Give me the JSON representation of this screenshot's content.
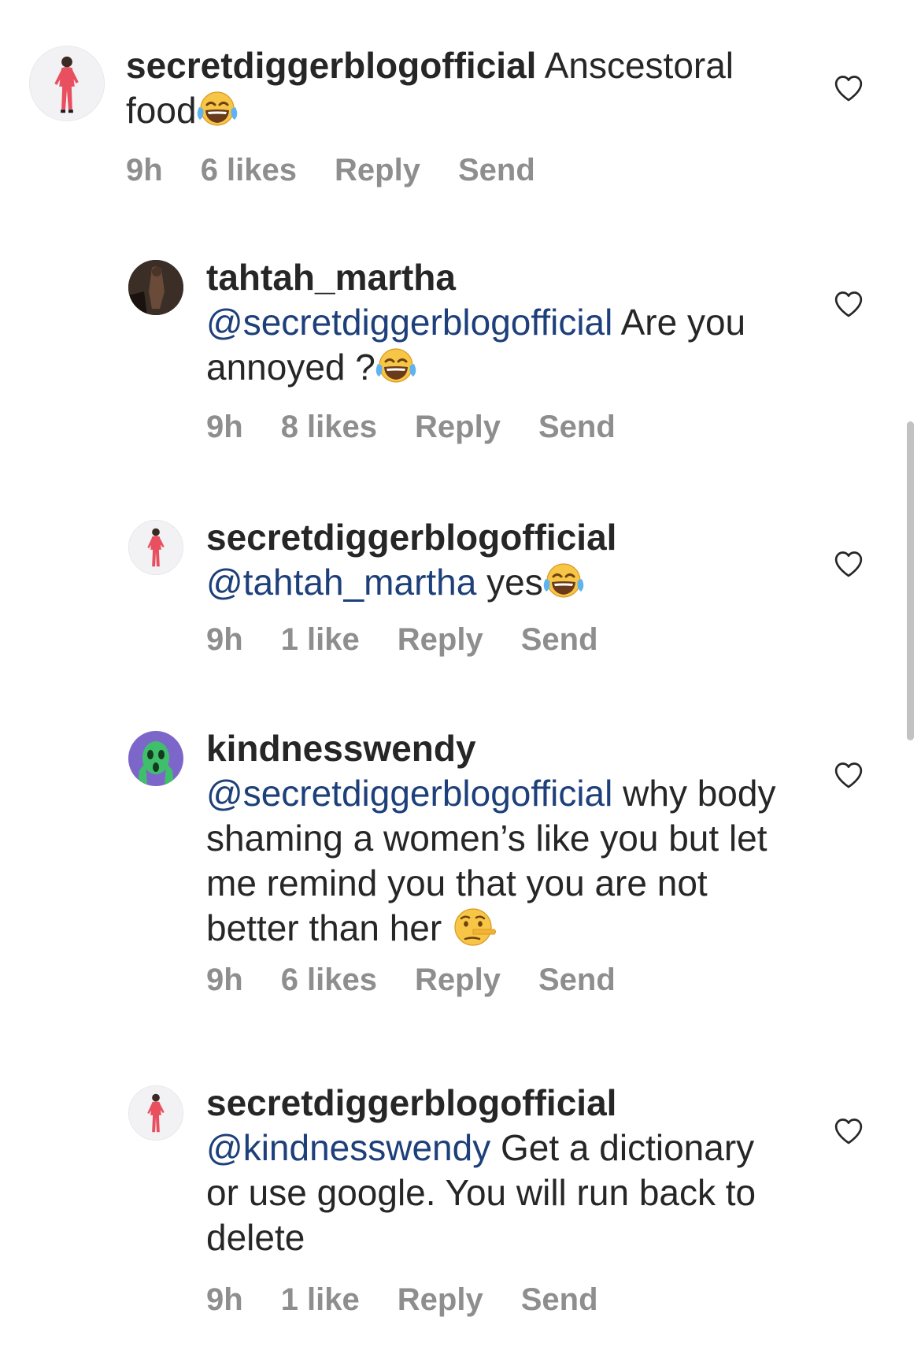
{
  "comments": [
    {
      "username": "secretdiggerblogofficial",
      "mention": "",
      "text": "Anscestoral food",
      "emoji": "joy",
      "time": "9h",
      "likes": "6 likes",
      "reply": "Reply",
      "send": "Send"
    },
    {
      "username": "tahtah_martha",
      "mention": "@secretdiggerblogofficial",
      "text": "Are you annoyed ?",
      "emoji": "joy",
      "time": "9h",
      "likes": "8 likes",
      "reply": "Reply",
      "send": "Send"
    },
    {
      "username": "secretdiggerblogofficial",
      "mention": "@tahtah_martha",
      "text": "yes",
      "emoji": "joy",
      "time": "9h",
      "likes": "1 like",
      "reply": "Reply",
      "send": "Send"
    },
    {
      "username": "kindnesswendy",
      "mention": "@secretdiggerblogofficial",
      "text": "why body shaming a women’s like you but let me remind you that you are not better than her",
      "emoji": "lying-face",
      "time": "9h",
      "likes": "6 likes",
      "reply": "Reply",
      "send": "Send"
    },
    {
      "username": "secretdiggerblogofficial",
      "mention": "@kindnesswendy",
      "text": "Get a dictionary or use google. You will run back to delete",
      "emoji": "",
      "time": "9h",
      "likes": "1 like",
      "reply": "Reply",
      "send": "Send"
    }
  ],
  "icons": {
    "heart": "heart-outline-icon",
    "joy": "face-with-tears-of-joy-emoji",
    "lying": "lying-face-emoji"
  },
  "colors": {
    "text": "#262626",
    "meta": "#8e8e8e",
    "mention": "#1d3f7a",
    "avatar_pink": "#e8505f"
  }
}
